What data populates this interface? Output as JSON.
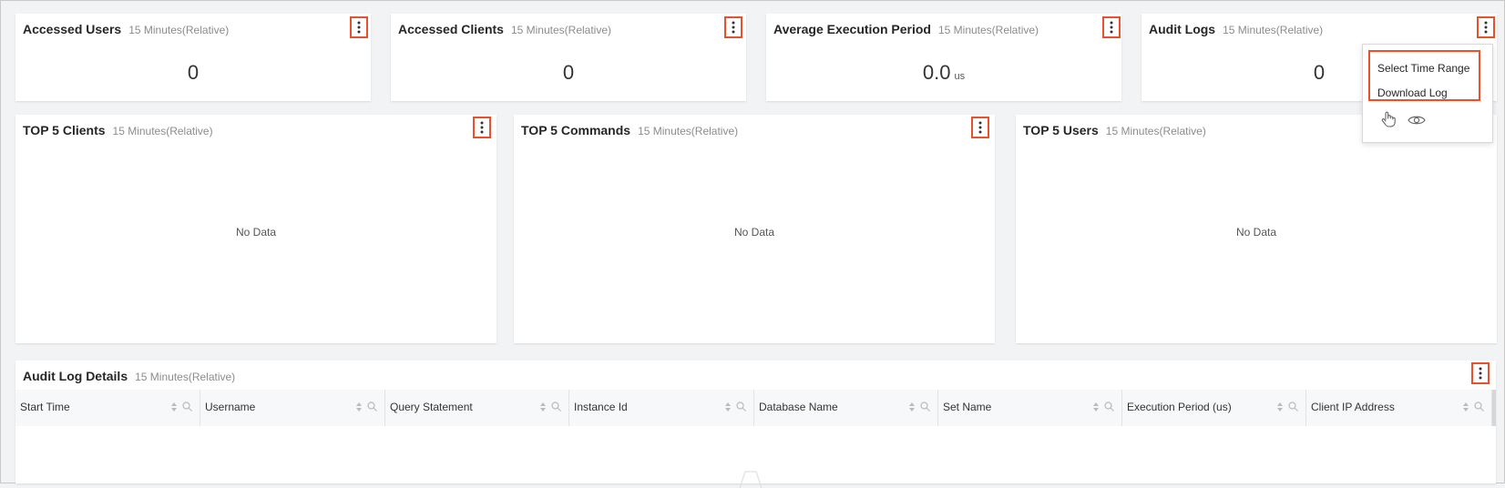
{
  "cards": {
    "accessed_users": {
      "title": "Accessed Users",
      "subtitle": "15 Minutes(Relative)",
      "value": "0"
    },
    "accessed_clients": {
      "title": "Accessed Clients",
      "subtitle": "15 Minutes(Relative)",
      "value": "0"
    },
    "avg_execution": {
      "title": "Average Execution Period",
      "subtitle": "15 Minutes(Relative)",
      "value": "0.0",
      "unit": "us"
    },
    "audit_logs": {
      "title": "Audit Logs",
      "subtitle": "15 Minutes(Relative)",
      "value": "0"
    }
  },
  "panels": {
    "top_clients": {
      "title": "TOP 5 Clients",
      "subtitle": "15 Minutes(Relative)",
      "empty": "No Data"
    },
    "top_commands": {
      "title": "TOP 5 Commands",
      "subtitle": "15 Minutes(Relative)",
      "empty": "No Data"
    },
    "top_users": {
      "title": "TOP 5 Users",
      "subtitle": "15 Minutes(Relative)",
      "empty": "No Data"
    }
  },
  "menu": {
    "items": [
      "Select Time Range",
      "Download Log"
    ],
    "icons": [
      "hand-pointer-icon",
      "eye-icon"
    ]
  },
  "details": {
    "title": "Audit Log Details",
    "subtitle": "15 Minutes(Relative)",
    "columns": [
      "Start Time",
      "Username",
      "Query Statement",
      "Instance Id",
      "Database Name",
      "Set Name",
      "Execution Period (us)",
      "Client IP Address"
    ]
  },
  "colors": {
    "highlight": "#e8512c",
    "background": "#f2f3f5",
    "card": "#ffffff"
  }
}
